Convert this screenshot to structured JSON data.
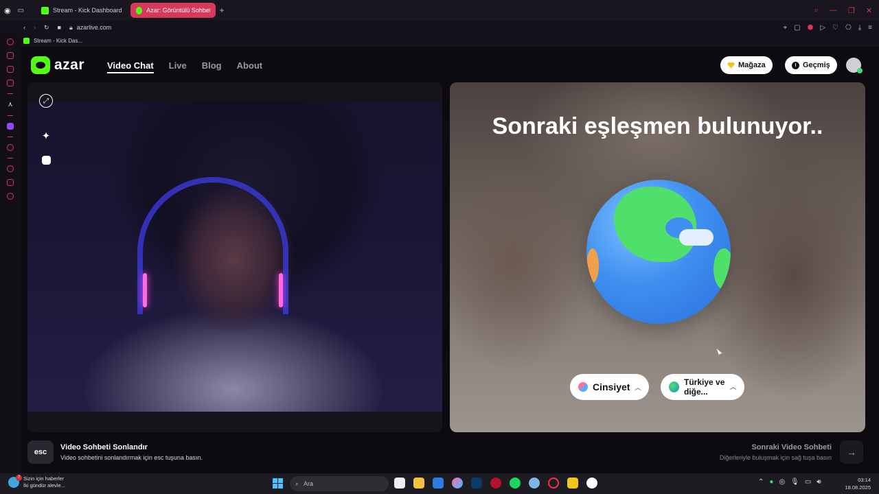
{
  "browser": {
    "tabs": [
      {
        "label": "Stream - Kick Dashboard",
        "favicon_color": "#53fc18",
        "active": false
      },
      {
        "label": "Azar: Görüntülü Sohbet, A",
        "favicon_color": "#53fc18",
        "active": true
      }
    ],
    "url": "azarlive.com",
    "bookmark": "Stream - Kick Das..."
  },
  "site": {
    "logo_text": "azar",
    "nav": [
      {
        "label": "Video Chat",
        "active": true
      },
      {
        "label": "Live",
        "active": false
      },
      {
        "label": "Blog",
        "active": false
      },
      {
        "label": "About",
        "active": false
      }
    ],
    "store_button": "Mağaza",
    "history_button": "Geçmiş",
    "accent_color": "#53fc18"
  },
  "match": {
    "status_text": "Sonraki eşleşmen bulunuyor..",
    "gender_filter": "Cinsiyet",
    "country_filter": "Türkiye ve diğe..."
  },
  "footer": {
    "esc_key": "esc",
    "end_title": "Video Sohbeti Sonlandır",
    "end_desc": "Video sohbetini sonlandırmak için esc tuşuna basın.",
    "next_title": "Sonraki Video Sohbeti",
    "next_desc": "Diğerleriyle buluşmak için sağ tuşa basın"
  },
  "taskbar": {
    "news_line1": "Sizin için haberler",
    "news_line2": "İki gündür alevle...",
    "news_badge": "7",
    "search_placeholder": "Ara",
    "time": "03:14",
    "date": "18.08.2025"
  }
}
